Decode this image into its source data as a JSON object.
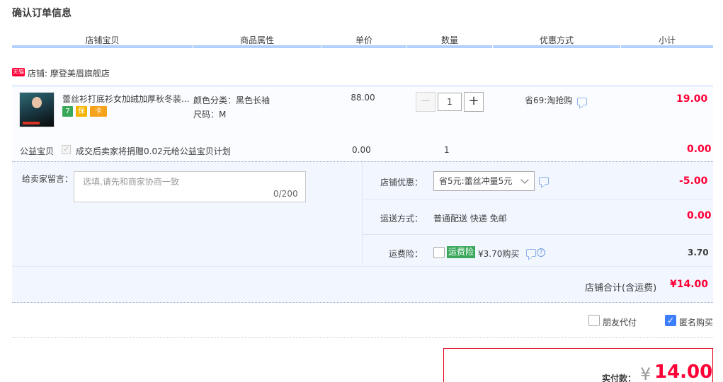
{
  "page_title": "确认订单信息",
  "columns": [
    "店铺宝贝",
    "商品属性",
    "单价",
    "数量",
    "优惠方式",
    "小计"
  ],
  "shop": {
    "badge": "天猫",
    "label": "店铺: 摩登美眉旗舰店"
  },
  "item": {
    "title": "蕾丝衫打底衫女加绒加厚秋冬装...",
    "icons": [
      "7",
      "保",
      "卡"
    ],
    "props": [
      "颜色分类：黑色长袖",
      "尺码：M"
    ],
    "price": "88.00",
    "quantity": "1",
    "qty_minus": "−",
    "qty_plus": "+",
    "discount": "省69:淘抢购",
    "subtotal": "19.00"
  },
  "charity": {
    "label": "公益宝贝",
    "check_mark": "✓",
    "text": "成交后卖家将捐赠0.02元给公益宝贝计划",
    "price": "0.00",
    "quantity": "1",
    "subtotal": "0.00"
  },
  "note": {
    "label": "给卖家留言：",
    "placeholder": "选填,请先和商家协商一致",
    "counter": "0/200"
  },
  "shop_discount": {
    "label": "店铺优惠：",
    "selected": "省5元:蕾丝冲量5元",
    "amount": "-5.00"
  },
  "shipping": {
    "label": "运送方式：",
    "value": "普通配送 快递 免邮",
    "amount": "0.00"
  },
  "insurance": {
    "label": "运费险：",
    "tag": "运费险",
    "price_text": "¥3.70购买",
    "help": "?",
    "amount": "3.70"
  },
  "shop_total": {
    "label": "店铺合计(含运费)",
    "value": "¥14.00"
  },
  "options": [
    {
      "label": "朋友代付",
      "checked": false
    },
    {
      "label": "匿名购买",
      "checked": true,
      "check_mark": "✓"
    }
  ],
  "payment": {
    "label": "实付款：",
    "yen": "¥",
    "value": "14.00"
  },
  "colors": {
    "accent_red": "#ff0036",
    "header_bar": "#b2d1ff",
    "checkbox_blue": "#3d7eff",
    "insurance_green": "#3aa85b"
  }
}
